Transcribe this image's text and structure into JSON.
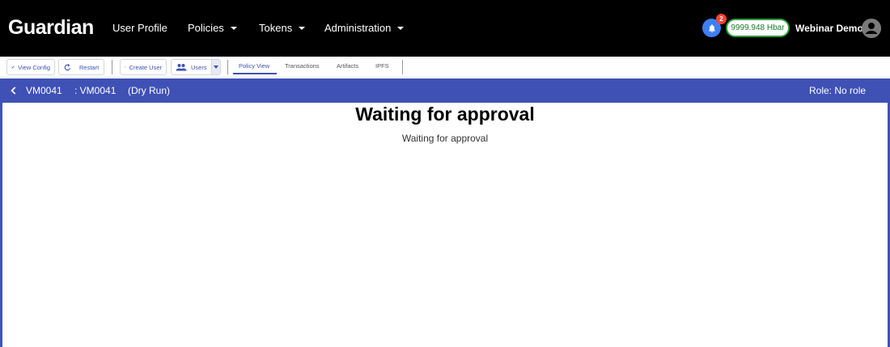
{
  "app": {
    "brand": "Guardian"
  },
  "nav": {
    "user_profile": "User Profile",
    "policies": "Policies",
    "tokens": "Tokens",
    "administration": "Administration"
  },
  "header": {
    "notification_count": "2",
    "balance": "9999.948 Hbar",
    "username": "Webinar Demo",
    "colors": {
      "bell": "#3f7ff5",
      "badge": "#f44336",
      "balance_border": "#2e9c3a"
    }
  },
  "toolbar": {
    "view_config": "View Config",
    "restart": "Restart",
    "create_user": "Create User",
    "users": "Users",
    "tabs": [
      "Policy View",
      "Transactions",
      "Artifacts",
      "IPFS"
    ],
    "active_tab": "Policy View"
  },
  "policy": {
    "id": "VM0041",
    "name": ": VM0041",
    "mode": "(Dry Run)",
    "role": "Role: No role",
    "accent": "#3f51b5"
  },
  "main": {
    "title": "Waiting for approval",
    "subtitle": "Waiting for approval"
  }
}
